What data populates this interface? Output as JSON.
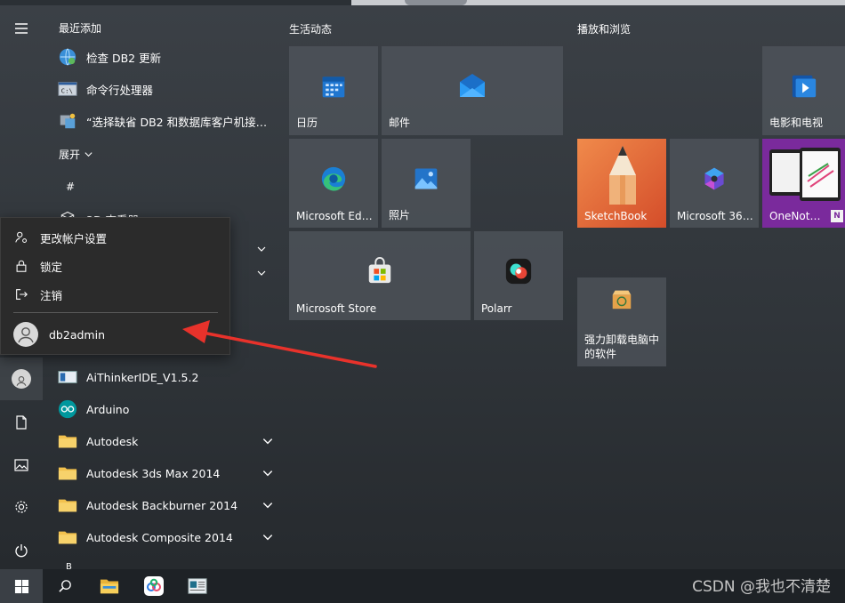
{
  "recent": {
    "header": "最近添加",
    "items": [
      {
        "label": "检查 DB2 更新",
        "icon": "globe-update-icon"
      },
      {
        "label": "命令行处理器",
        "icon": "command-prompt-icon"
      },
      {
        "label": "“选择缺省 DB2 和数据库客户机接口”...",
        "icon": "db2-interface-icon"
      }
    ],
    "expand_label": "展开"
  },
  "list": {
    "hash_header": "#",
    "partial_item": "3D 查看器",
    "items": [
      {
        "label": "AiThinkerIDE_V1.5.2",
        "icon": "ide-window-icon",
        "chevron": false
      },
      {
        "label": "Arduino",
        "icon": "arduino-icon",
        "chevron": false
      },
      {
        "label": "Autodesk",
        "icon": "folder-icon",
        "chevron": true
      },
      {
        "label": "Autodesk 3ds Max 2014",
        "icon": "folder-icon",
        "chevron": true
      },
      {
        "label": "Autodesk Backburner 2014",
        "icon": "folder-icon",
        "chevron": true
      },
      {
        "label": "Autodesk Composite 2014",
        "icon": "folder-icon",
        "chevron": true
      }
    ],
    "next_letter": "B"
  },
  "account_flyout": {
    "change_settings": "更改帐户设置",
    "lock": "锁定",
    "sign_out": "注销",
    "username": "db2admin"
  },
  "tiles": {
    "section_life": "生活动态",
    "section_play": "播放和浏览",
    "calendar": "日历",
    "mail": "邮件",
    "edge": "Microsoft Edge",
    "photos": "照片",
    "store": "Microsoft Store",
    "polarr": "Polarr",
    "movies": "电影和电视",
    "sketchbook": "SketchBook",
    "m365": "Microsoft 365...",
    "onenote": "OneNote...",
    "uninstall_line1": "强力卸载电脑中",
    "uninstall_line2": "的软件"
  },
  "watermark": "CSDN @我也不清楚",
  "colors": {
    "arrow": "#e8322b",
    "accent_blue": "#2b88d8",
    "folder": "#f2c14e",
    "sketchbook": "#e9693a",
    "onenote": "#7a2a9c"
  }
}
